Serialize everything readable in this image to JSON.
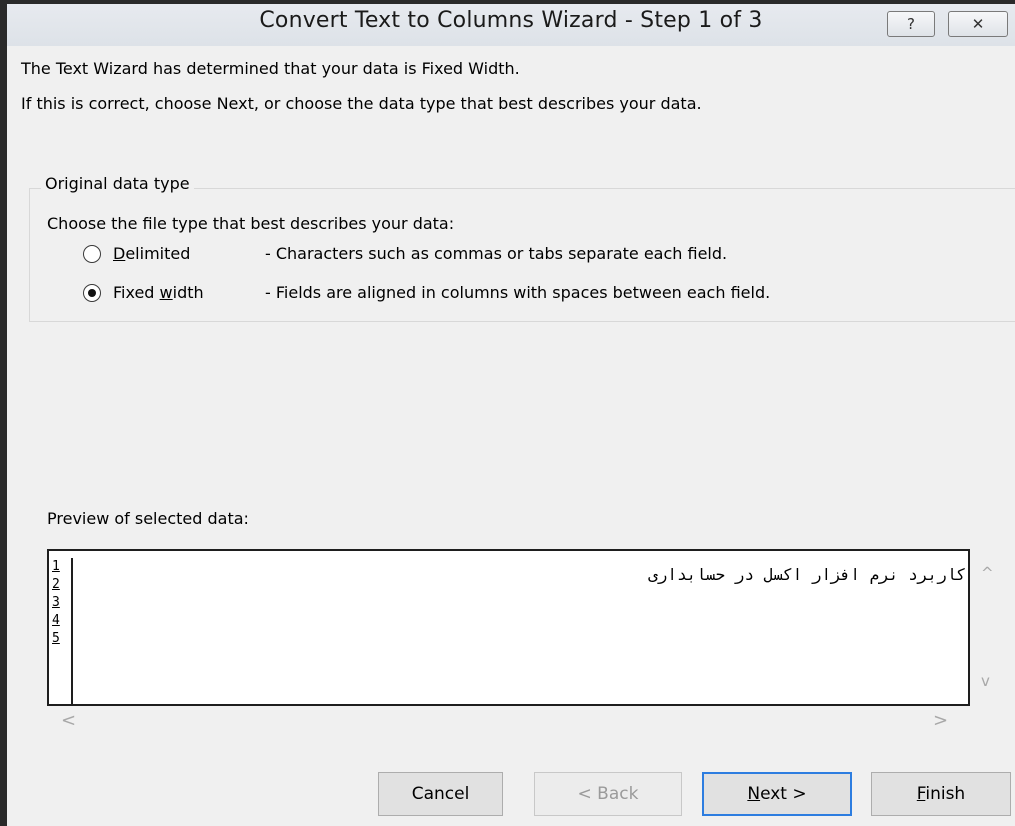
{
  "window": {
    "title": "Convert Text to Columns Wizard - Step 1 of 3",
    "help_glyph": "?",
    "close_glyph": "✕"
  },
  "intro": {
    "line1": "The Text Wizard has determined that your data is Fixed Width.",
    "line2": "If this is correct, choose Next, or choose the data type that best describes your data."
  },
  "data_type_group": {
    "legend": "Original data type",
    "prompt": "Choose the file type that best describes your data:",
    "options": [
      {
        "label_pre": "",
        "accesskey": "D",
        "label_post": "elimited",
        "description": "- Characters such as commas or tabs separate each field.",
        "selected": false
      },
      {
        "label_pre": "Fixed ",
        "accesskey": "w",
        "label_post": "idth",
        "description": "- Fields are aligned in columns with spaces between each field.",
        "selected": true
      }
    ]
  },
  "preview": {
    "label": "Preview of selected data:",
    "row_numbers": [
      "1",
      "2",
      "3",
      "4",
      "5"
    ],
    "rows": [
      "کاربرد نرم افزار اکسل در حسابداری",
      "",
      "",
      "",
      ""
    ],
    "scroll_up": "^",
    "scroll_down": "v",
    "scroll_left": "<",
    "scroll_right": ">"
  },
  "buttons": {
    "cancel": "Cancel",
    "back": "< Back",
    "next_accesskey": "N",
    "next_rest": "ext >",
    "finish_accesskey": "F",
    "finish_rest": "inish"
  }
}
